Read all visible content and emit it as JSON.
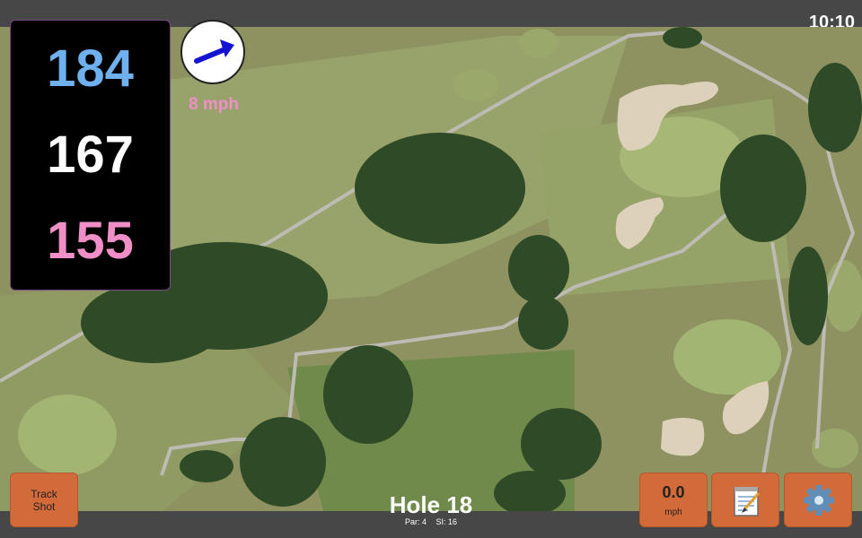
{
  "status": {
    "time": "10:10"
  },
  "distances": {
    "back": "184",
    "middle": "167",
    "front": "155",
    "colors": {
      "back": "#6fb0ee",
      "middle": "#ffffff",
      "front": "#f08ec8"
    }
  },
  "wind": {
    "speed_text": "8 mph",
    "arrow_icon": "wind-direction-arrow-icon",
    "color": "#f08ec8"
  },
  "buttons": {
    "track_shot": "Track Shot",
    "speed_value": "0.0",
    "speed_unit": "mph",
    "notes_icon": "notepad-icon",
    "settings_icon": "gear-icon",
    "accent": "#d36a3a"
  },
  "hole": {
    "title": "Hole 18",
    "par": "Par: 4",
    "si": "SI: 16"
  }
}
